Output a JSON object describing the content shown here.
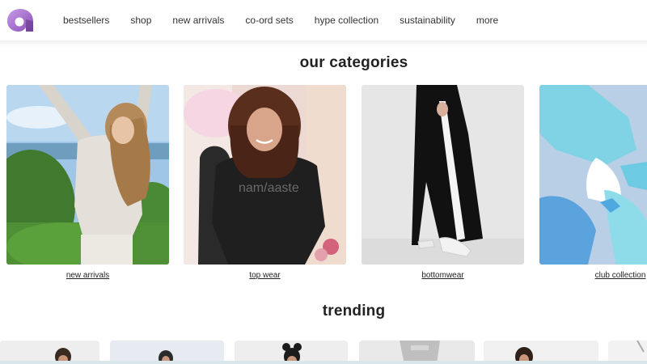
{
  "brand": {
    "logo_icon": "brand-logo-icon",
    "colors": {
      "logo_purple": "#b57cd8",
      "logo_dark": "#6a3d8c",
      "accent_cyan": "#73d3e6"
    }
  },
  "nav": {
    "items": [
      {
        "label": "bestsellers"
      },
      {
        "label": "shop"
      },
      {
        "label": "new arrivals"
      },
      {
        "label": "co-ord sets"
      },
      {
        "label": "hype collection"
      },
      {
        "label": "sustainability"
      },
      {
        "label": "more"
      }
    ]
  },
  "categories": {
    "title": "our categories",
    "items": [
      {
        "label": "new arrivals"
      },
      {
        "label": "top wear"
      },
      {
        "label": "bottomwear"
      },
      {
        "label": "club collection"
      }
    ],
    "shirt_print": "nam/aaste"
  },
  "trending": {
    "title": "trending"
  }
}
